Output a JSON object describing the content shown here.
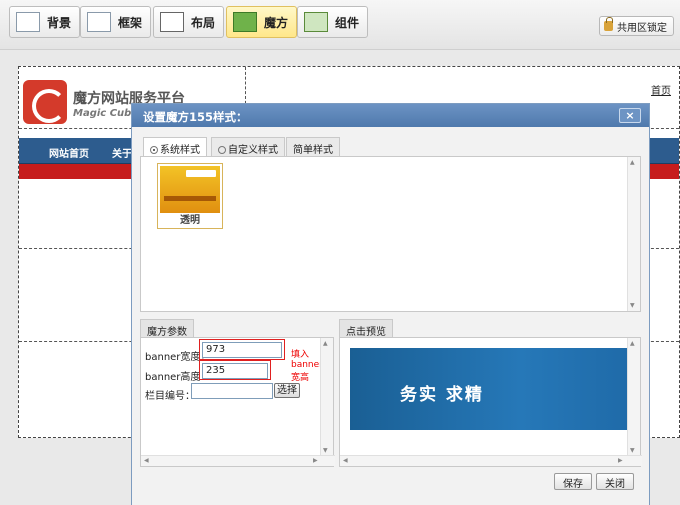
{
  "toolbar": {
    "buttons": [
      {
        "label": "背景"
      },
      {
        "label": "框架"
      },
      {
        "label": "布局"
      },
      {
        "label": "魔方"
      },
      {
        "label": "组件"
      }
    ],
    "lock_label": "共用区锁定"
  },
  "site": {
    "name": "魔方网站服务平台",
    "subtitle": "Magic Cube",
    "home_link": "首页",
    "nav": [
      "网站首页",
      "关于"
    ]
  },
  "dialog": {
    "title": "设置魔方155样式：",
    "close": "×",
    "tabs": [
      "系统样式",
      "自定义样式",
      "简单样式"
    ],
    "thumbnail_label": "透明",
    "params_tab": "魔方参数",
    "preview_tab": "点击预览",
    "fields": {
      "width_label": "banner宽度：",
      "width_value": "973",
      "height_label": "banner高度：",
      "height_value": "235",
      "column_label": "栏目编号：",
      "column_value": "",
      "select_label": "选择",
      "hint": "填入banner 宽高"
    },
    "preview_text": "务实 求精",
    "save_label": "保存",
    "close_label": "关闭"
  }
}
